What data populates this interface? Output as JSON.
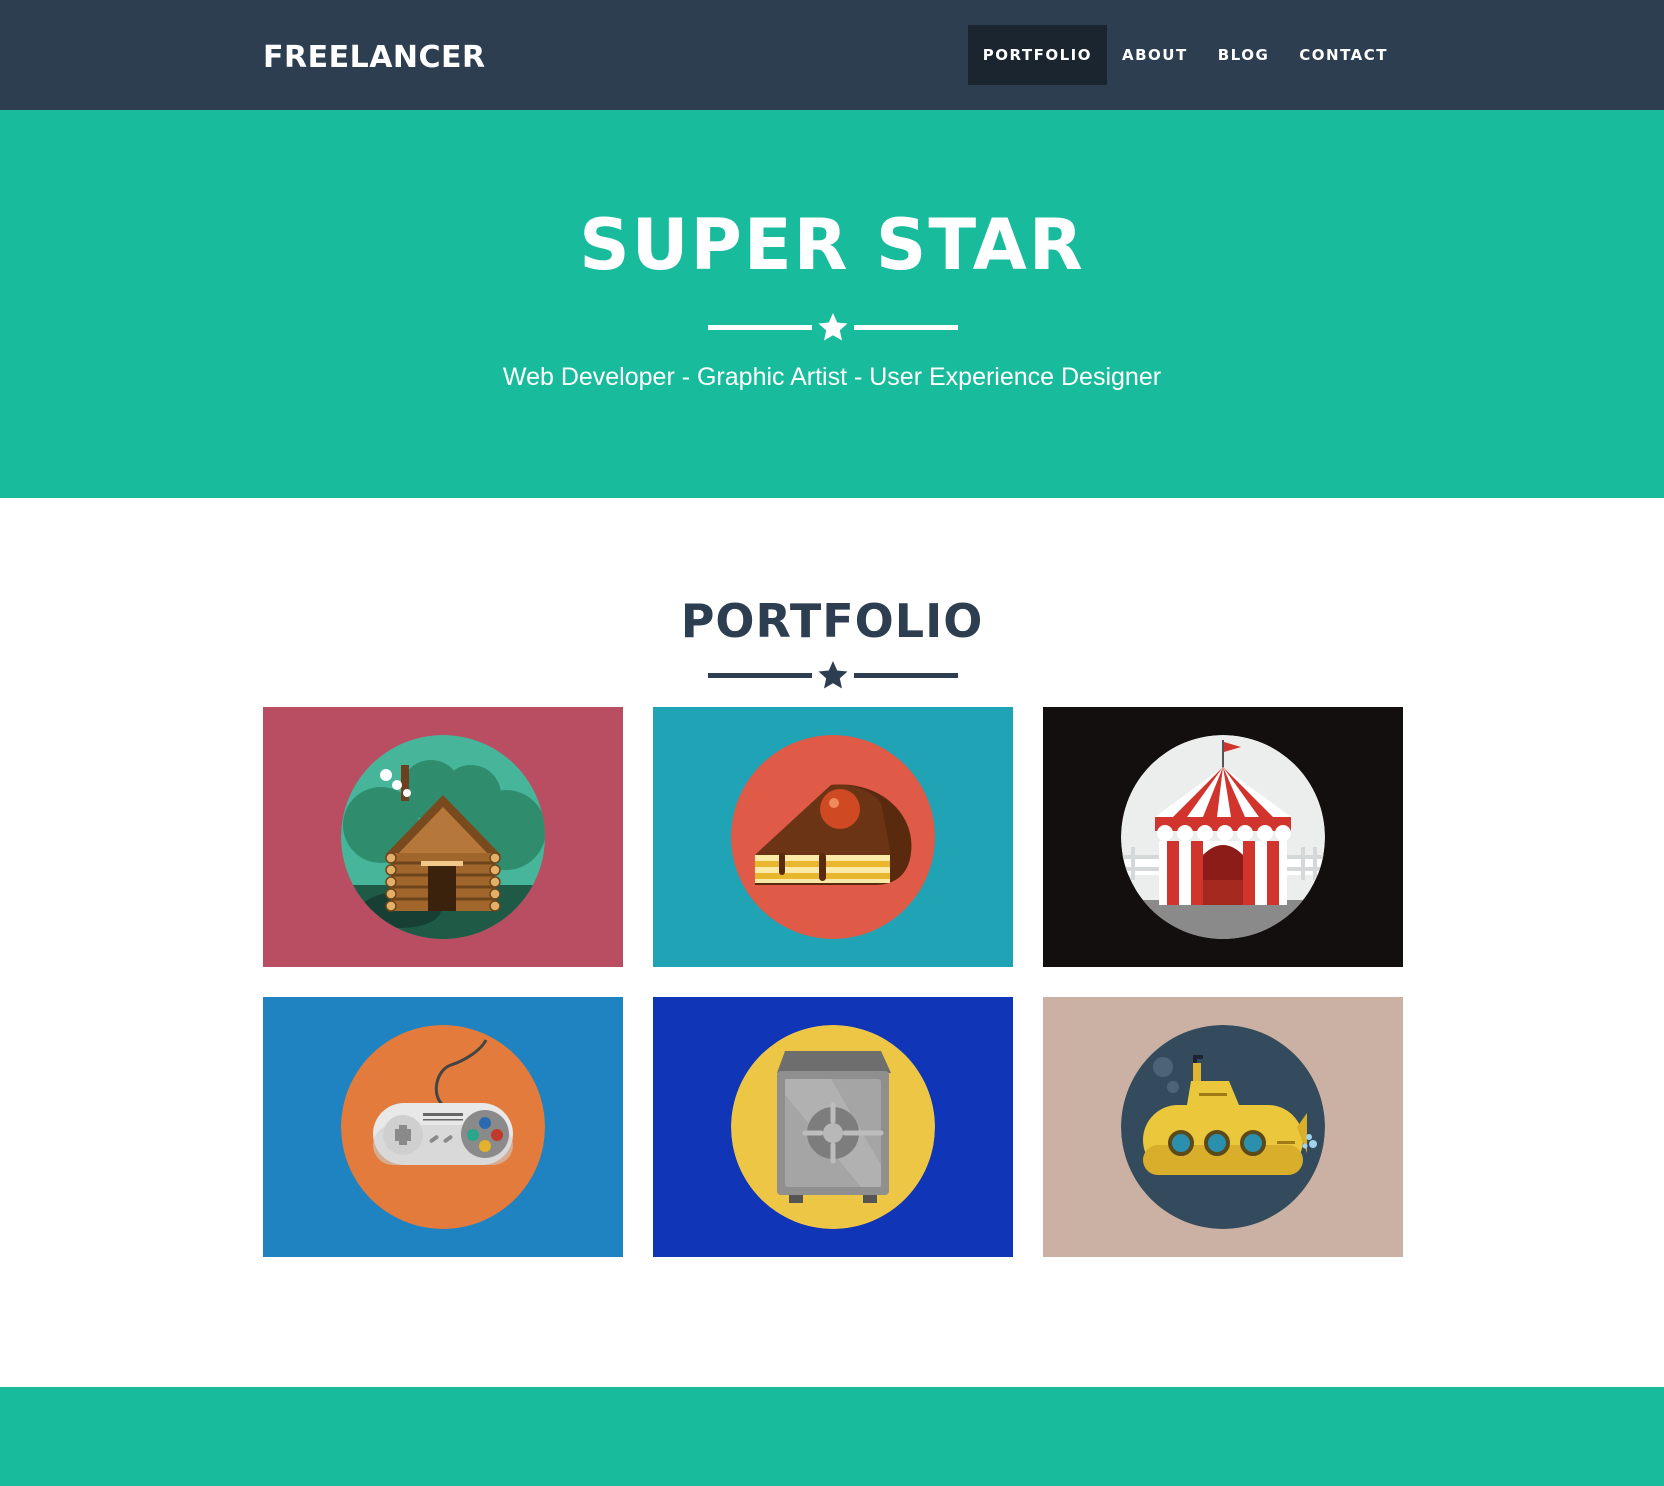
{
  "navbar": {
    "brand": "FREELANCER",
    "items": [
      {
        "label": "PORTFOLIO",
        "active": true
      },
      {
        "label": "ABOUT"
      },
      {
        "label": "BLOG"
      },
      {
        "label": "CONTACT"
      }
    ]
  },
  "hero": {
    "title": "SUPER STAR",
    "subtitle": "Web Developer - Graphic Artist - User Experience Designer",
    "divider_icon": "star-icon"
  },
  "portfolio": {
    "title": "PORTFOLIO",
    "divider_icon": "star-icon",
    "items": [
      {
        "icon": "cabin-icon",
        "bg": "#b94e62",
        "circle": "#46b59a"
      },
      {
        "icon": "cake-icon",
        "bg": "#20a3b4",
        "circle": "#e05a48"
      },
      {
        "icon": "circus-tent-icon",
        "bg": "#130f0f",
        "circle": "#eceeee"
      },
      {
        "icon": "game-controller-icon",
        "bg": "#1f83c2",
        "circle": "#e27b3b"
      },
      {
        "icon": "safe-icon",
        "bg": "#1035b6",
        "circle": "#eec645"
      },
      {
        "icon": "submarine-icon",
        "bg": "#cbb1a3",
        "circle": "#344b5e"
      }
    ]
  },
  "colors": {
    "navbar": "#2c3e50",
    "navbar_active": "#1a252f",
    "primary": "#18bc9c",
    "heading": "#2c3e50"
  }
}
